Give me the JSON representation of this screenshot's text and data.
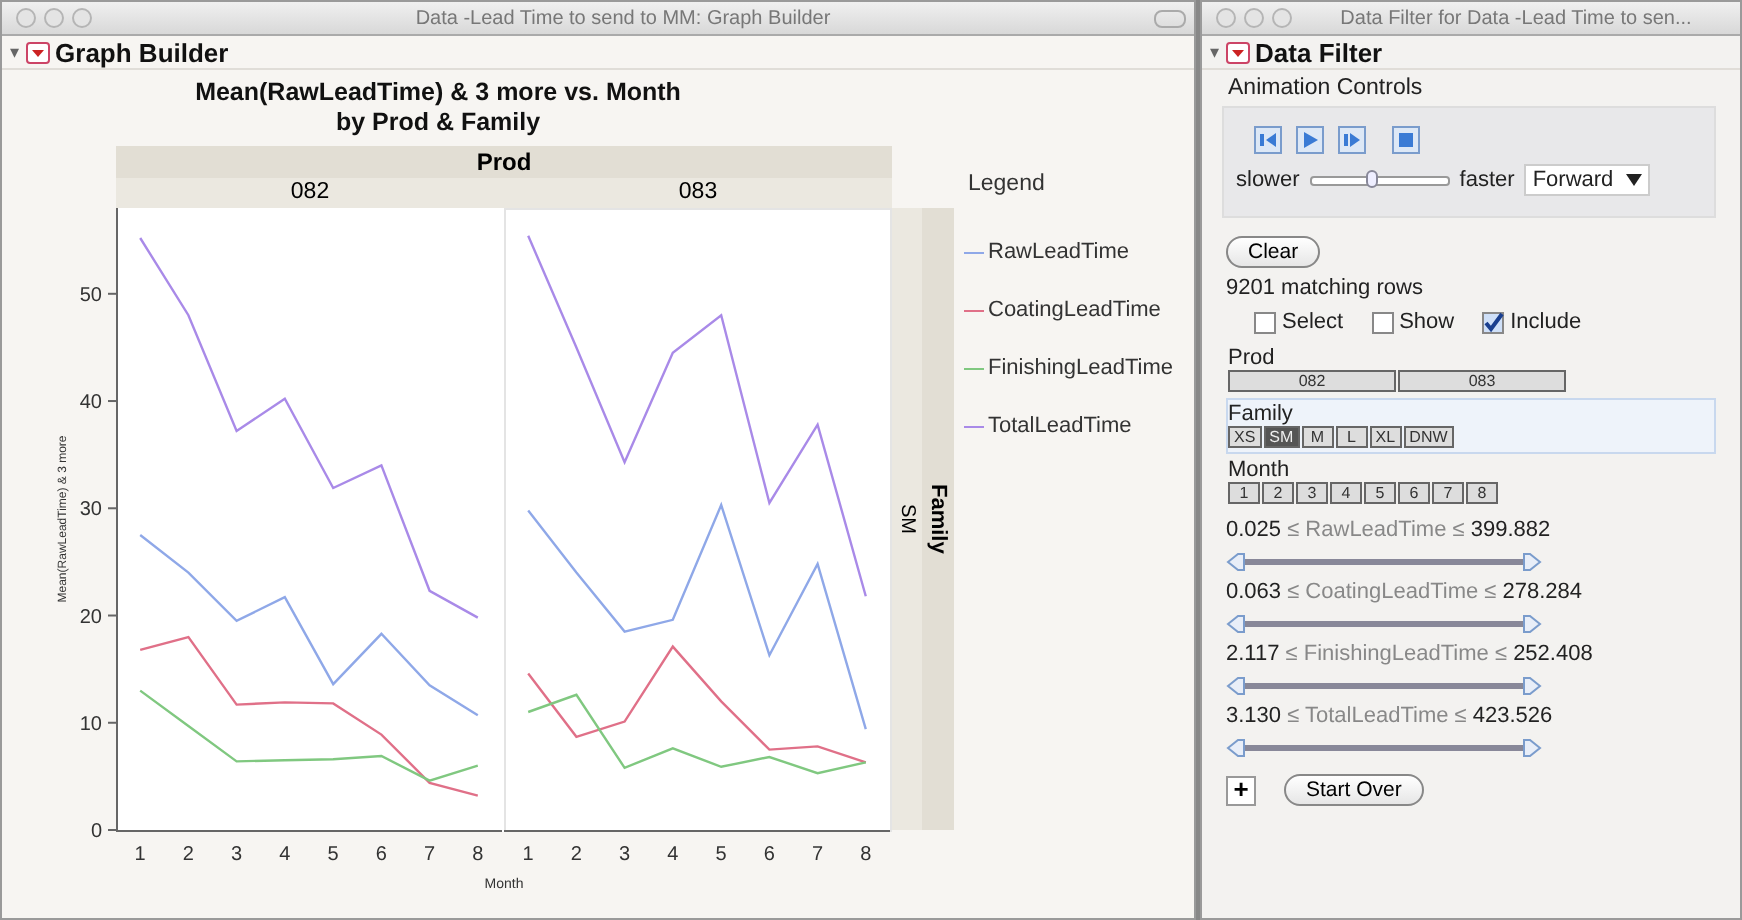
{
  "graph_window": {
    "title": "Data -Lead Time to send to MM: Graph Builder",
    "header": "Graph Builder",
    "graph_title": "Mean(RawLeadTime) & 3 more vs. Month",
    "graph_subtitle": "by Prod & Family",
    "group_title": "Prod",
    "panels": [
      {
        "label": "082",
        "chart_data": {
          "type": "line",
          "ylabel": "Mean(RawLeadTime) & 3 more",
          "categories": [
            "1",
            "2",
            "3",
            "4",
            "5",
            "6",
            "7",
            "8"
          ],
          "ylim": [
            0,
            58
          ],
          "yticks": [
            0,
            10,
            20,
            30,
            40,
            50
          ],
          "series": [
            {
              "name": "RawLeadTime",
              "color": "#8fa8e8",
              "values": [
                27.5,
                24,
                19.5,
                21.7,
                13.6,
                18.3,
                13.5,
                10.7
              ]
            },
            {
              "name": "CoatingLeadTime",
              "color": "#e07088",
              "values": [
                16.8,
                18,
                11.7,
                11.9,
                11.8,
                8.9,
                4.4,
                3.2
              ]
            },
            {
              "name": "FinishingLeadTime",
              "color": "#80c880",
              "values": [
                13,
                9.7,
                6.4,
                6.5,
                6.6,
                6.9,
                4.6,
                6
              ]
            },
            {
              "name": "TotalLeadTime",
              "color": "#a98ae8",
              "values": [
                55.2,
                48,
                37.2,
                40.2,
                31.9,
                34,
                22.3,
                19.8
              ]
            }
          ]
        }
      },
      {
        "label": "083",
        "chart_data": {
          "type": "line",
          "categories": [
            "1",
            "2",
            "3",
            "4",
            "5",
            "6",
            "7",
            "8"
          ],
          "ylim": [
            0,
            58
          ],
          "series": [
            {
              "color": "#8fa8e8",
              "values": [
                29.8,
                24,
                18.5,
                19.6,
                30.3,
                16.3,
                24.8,
                9.4
              ]
            },
            {
              "color": "#e07088",
              "values": [
                14.6,
                8.7,
                10.1,
                17.1,
                12,
                7.5,
                7.8,
                6.3
              ]
            },
            {
              "color": "#80c880",
              "values": [
                11,
                12.6,
                5.8,
                7.6,
                5.9,
                6.8,
                5.3,
                6.3
              ]
            },
            {
              "color": "#a98ae8",
              "values": [
                55.4,
                45,
                34.3,
                44.5,
                48,
                30.5,
                37.8,
                21.8
              ]
            }
          ]
        }
      }
    ],
    "family_strip": {
      "title": "Family",
      "value": "SM"
    },
    "xlabel": "Month",
    "legend": {
      "title": "Legend"
    },
    "toggle": "▾"
  },
  "filter_window": {
    "title": "Data Filter for Data -Lead Time to sen...",
    "header": "Data Filter",
    "toggle": "▾",
    "animation": {
      "title": "Animation Controls",
      "slower": "slower",
      "faster": "faster",
      "speed": {
        "level": 0.45
      },
      "direction": "Forward"
    },
    "clear": "Clear",
    "matching": "9201 matching rows",
    "modes": [
      {
        "label": "Select",
        "checked": false
      },
      {
        "label": "Show",
        "checked": false
      },
      {
        "label": "Include",
        "checked": true
      }
    ],
    "groups": [
      {
        "title": "Prod",
        "values": [
          {
            "label": "082",
            "selected": false
          },
          {
            "label": "083",
            "selected": false
          }
        ]
      },
      {
        "title": "Family",
        "values": [
          {
            "label": "XS",
            "selected": false
          },
          {
            "label": "SM",
            "selected": true
          },
          {
            "label": "M",
            "selected": false
          },
          {
            "label": "L",
            "selected": false
          },
          {
            "label": "XL",
            "selected": false
          },
          {
            "label": "DNW",
            "selected": false
          }
        ]
      },
      {
        "title": "Month",
        "values": [
          {
            "label": "1",
            "selected": false
          },
          {
            "label": "2",
            "selected": false
          },
          {
            "label": "3",
            "selected": false
          },
          {
            "label": "4",
            "selected": false
          },
          {
            "label": "5",
            "selected": false
          },
          {
            "label": "6",
            "selected": false
          },
          {
            "label": "7",
            "selected": false
          },
          {
            "label": "8",
            "selected": false
          }
        ]
      }
    ],
    "ranges": [
      {
        "low": "0.025",
        "name": "≤ RawLeadTime ≤",
        "high": "399.882",
        "level": 1
      },
      {
        "low": "0.063",
        "name": "≤ CoatingLeadTime ≤",
        "high": "278.284",
        "level": 1
      },
      {
        "low": "2.117",
        "name": "≤ FinishingLeadTime ≤",
        "high": "252.408",
        "level": 1
      },
      {
        "low": "3.130",
        "name": "≤ TotalLeadTime ≤",
        "high": "423.526",
        "level": 1
      }
    ],
    "add": "+",
    "start_over": "Start Over"
  }
}
